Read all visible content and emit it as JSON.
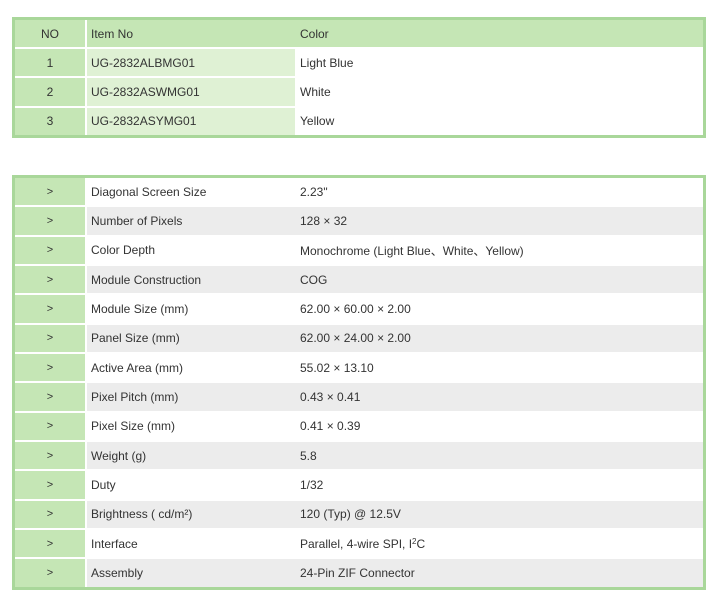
{
  "items_table": {
    "headers": [
      "NO",
      "Item No",
      "Color"
    ],
    "rows": [
      {
        "no": "1",
        "item": "UG-2832ALBMG01",
        "color": "Light Blue"
      },
      {
        "no": "2",
        "item": "UG-2832ASWMG01",
        "color": "White"
      },
      {
        "no": "3",
        "item": "UG-2832ASYMG01",
        "color": "Yellow"
      }
    ]
  },
  "specs_table": {
    "marker": ">",
    "rows": [
      {
        "label": "Diagonal Screen Size",
        "value": "2.23\""
      },
      {
        "label": "Number of Pixels",
        "value": "128 × 32"
      },
      {
        "label": "Color Depth",
        "value": "Monochrome (Light Blue、White、Yellow)"
      },
      {
        "label": "Module Construction",
        "value": "COG"
      },
      {
        "label": "Module Size (mm)",
        "value": "62.00 × 60.00 × 2.00"
      },
      {
        "label": "Panel Size (mm)",
        "value": "62.00 × 24.00 × 2.00"
      },
      {
        "label": "Active Area (mm)",
        "value": "55.02 × 13.10"
      },
      {
        "label": "Pixel Pitch (mm)",
        "value": "0.43 × 0.41"
      },
      {
        "label": "Pixel Size (mm)",
        "value": "0.41 × 0.39"
      },
      {
        "label": "Weight (g)",
        "value": "5.8"
      },
      {
        "label": "Duty",
        "value": "1/32"
      },
      {
        "label": "Brightness ( cd/m²)",
        "value": "120 (Typ) @ 12.5V"
      },
      {
        "label": "Interface",
        "value_before": "Parallel, 4-wire SPI, I",
        "value_sup": "2",
        "value_after": "C"
      },
      {
        "label": "Assembly",
        "value": "24-Pin ZIF Connector"
      }
    ]
  },
  "colors": {
    "border": "#a9d79a",
    "header_bg": "#c5e6b5",
    "item_cell_bg": "#dff1d4",
    "alt_row_bg": "#ececec"
  }
}
